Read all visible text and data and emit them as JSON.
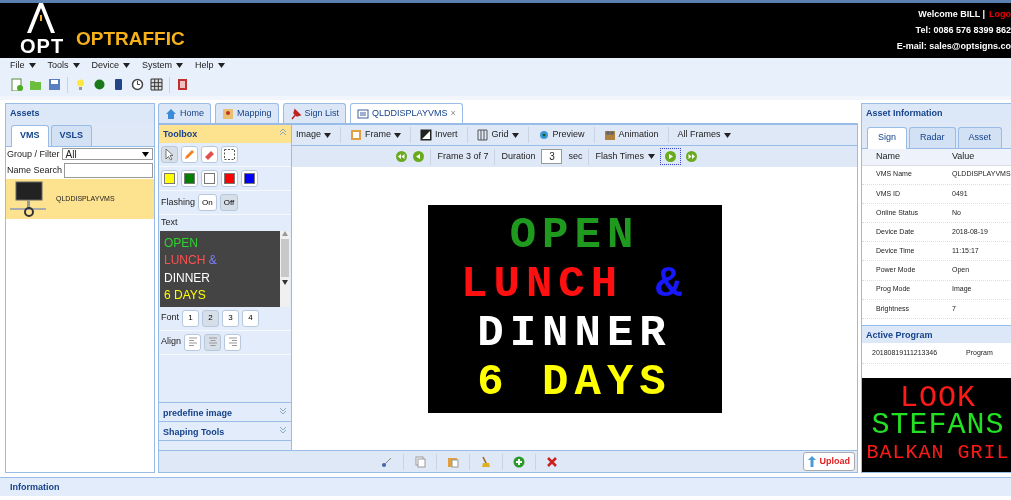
{
  "header": {
    "logo_mark": "OPT",
    "brand": "OPTRAFFIC",
    "welcome": "Welcome BILL |",
    "logout": "Logo",
    "tel": "Tel: 0086 576 8399 862",
    "email": "E-mail: sales@optsigns.co"
  },
  "menu": [
    "File",
    "Tools",
    "Device",
    "System",
    "Help"
  ],
  "assets": {
    "title": "Assets",
    "tabs": [
      {
        "label": "VMS",
        "selected": true
      },
      {
        "label": "VSLS",
        "selected": false
      }
    ],
    "filter_label": "Group / Filter",
    "filter_value": "All",
    "search_label": "Name Search",
    "items": [
      {
        "name": "QLDDISPLAYVMS",
        "selected": true
      }
    ]
  },
  "doc_tabs": [
    {
      "label": "Home",
      "kind": "home",
      "selected": false
    },
    {
      "label": "Mapping",
      "kind": "map",
      "selected": false
    },
    {
      "label": "Sign List",
      "kind": "pin",
      "selected": false
    },
    {
      "label": "QLDDISPLAYVMS",
      "kind": "sign",
      "selected": true,
      "close": "×"
    }
  ],
  "toolbox": {
    "title": "Toolbox",
    "tools": [
      {
        "kind": "pointer",
        "selected": true
      },
      {
        "kind": "pencil",
        "selected": false
      },
      {
        "kind": "eraser",
        "selected": false
      },
      {
        "kind": "select",
        "selected": false
      }
    ],
    "swatches": [
      {
        "color": "#ffff00",
        "selected": false
      },
      {
        "color": "#008000",
        "selected": false
      },
      {
        "color": "#ffffff",
        "selected": false
      },
      {
        "color": "#ff0000",
        "selected": false
      },
      {
        "color": "#0000ff",
        "selected": false
      }
    ],
    "flashing_label": "Flashing",
    "flashing": [
      {
        "label": "On",
        "selected": false
      },
      {
        "label": "Off",
        "selected": true
      }
    ],
    "text_label": "Text",
    "text_lines": [
      [
        {
          "text": "OPEN",
          "color": "#30d030"
        }
      ],
      [
        {
          "text": "LUNCH",
          "color": "#ff5050"
        },
        {
          "text": "&",
          "color": "#8080ff"
        }
      ],
      [
        {
          "text": "DINNER",
          "color": "#ffffff"
        }
      ],
      [
        {
          "text": "6 DAYS",
          "color": "#ffff00"
        }
      ]
    ],
    "font_label": "Font",
    "fonts": [
      {
        "label": "1",
        "selected": false
      },
      {
        "label": "2",
        "selected": true
      },
      {
        "label": "3",
        "selected": false
      },
      {
        "label": "4",
        "selected": false
      }
    ],
    "align_label": "Align",
    "aligns": [
      {
        "kind": "left",
        "selected": false
      },
      {
        "kind": "center",
        "selected": true
      },
      {
        "kind": "right",
        "selected": false
      }
    ],
    "sections": [
      "predefine image",
      "Shaping Tools"
    ]
  },
  "editor_toolbar": [
    {
      "label": "Image",
      "kind": "dropdown"
    },
    {
      "label": "Frame",
      "kind": "dropdown"
    },
    {
      "label": "Invert",
      "kind": "button"
    },
    {
      "label": "Grid",
      "kind": "dropdown"
    },
    {
      "label": "Preview",
      "kind": "button"
    },
    {
      "label": "Animation",
      "kind": "button"
    },
    {
      "label": "All Frames",
      "kind": "dropdown"
    }
  ],
  "frame_nav": {
    "frame": "Frame 3 of 7",
    "duration_label": "Duration",
    "duration": "3",
    "unit": "sec",
    "flash": "Flash Times"
  },
  "sign": {
    "lines": [
      [
        {
          "text": "OPEN",
          "color": "#1f9a1f"
        }
      ],
      [
        {
          "text": "LUNCH",
          "color": "#ff1010"
        },
        {
          "text": "&",
          "color": "#1818ff"
        }
      ],
      [
        {
          "text": "DINNER",
          "color": "#ffffff"
        }
      ],
      [
        {
          "text": "6 DAYS",
          "color": "#ffff00"
        }
      ]
    ]
  },
  "upload": "Upload",
  "asset_info": {
    "title": "Asset Information",
    "tabs": [
      {
        "label": "Sign",
        "selected": true
      },
      {
        "label": "Radar",
        "selected": false
      },
      {
        "label": "Asset",
        "selected": false
      }
    ],
    "columns": [
      "Name",
      "Value"
    ],
    "rows": [
      [
        "VMS Name",
        "QLDDISPLAYVMS"
      ],
      [
        "VMS ID",
        "0491"
      ],
      [
        "Online Status",
        "No"
      ],
      [
        "Device Date",
        "2018-08-19"
      ],
      [
        "Device Time",
        "11:15:17"
      ],
      [
        "Power Mode",
        "Open"
      ],
      [
        "Prog Mode",
        "Image"
      ],
      [
        "Brightness",
        "7"
      ]
    ]
  },
  "active_program": {
    "title": "Active Program",
    "rows": [
      [
        "20180819111213346",
        "Program"
      ]
    ],
    "preview": [
      {
        "text": "LOOK",
        "color": "#ff1a1a"
      },
      {
        "text": "STEFANS",
        "color": "#22e022"
      },
      {
        "text": "BALKAN GRIL",
        "color": "#ff1a1a"
      }
    ]
  },
  "footer": "Information"
}
